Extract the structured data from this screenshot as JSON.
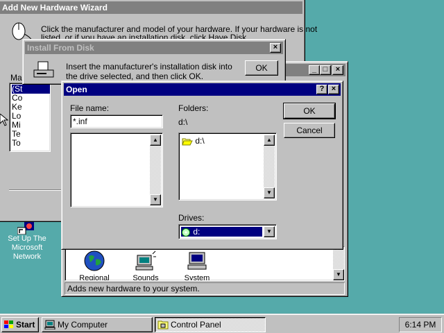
{
  "desktop": {
    "network_icon_label_lines": [
      "Set Up The",
      "Microsoft",
      "Network"
    ]
  },
  "wizard": {
    "title": "Add New Hardware Wizard",
    "instructions_line1": "Click the manufacturer and model of your hardware. If your hardware is not",
    "instructions_line2": "listed, or if you have an installation disk, click Have Disk.",
    "list_label_fragment": "Mar",
    "list_items": [
      "(St",
      "Co",
      "Ke",
      "Lo",
      "Mi",
      "Te",
      "To"
    ]
  },
  "install_from_disk": {
    "title": "Install From Disk",
    "message_line1": "Insert the manufacturer's installation disk into",
    "message_line2": "the drive selected, and then click OK.",
    "ok_label": "OK"
  },
  "control_panel": {
    "icons": [
      "Regional",
      "Sounds",
      "System"
    ],
    "status_text": "Adds new hardware to your system."
  },
  "open_dialog": {
    "title": "Open",
    "file_name_label": "File name:",
    "file_name_value": "*.inf",
    "folders_label": "Folders:",
    "current_path": "d:\\",
    "folder_items": [
      "d:\\"
    ],
    "drives_label": "Drives:",
    "drive_selected": "d:",
    "ok_label": "OK",
    "cancel_label": "Cancel"
  },
  "taskbar": {
    "start_label": "Start",
    "tasks": [
      "My Computer",
      "Control Panel"
    ],
    "clock": "6:14 PM"
  },
  "colors": {
    "desktop": "#55aaaa",
    "active_title": "#000080",
    "inactive_title": "#808080",
    "face": "#c0c0c0",
    "selection": "#000080"
  }
}
